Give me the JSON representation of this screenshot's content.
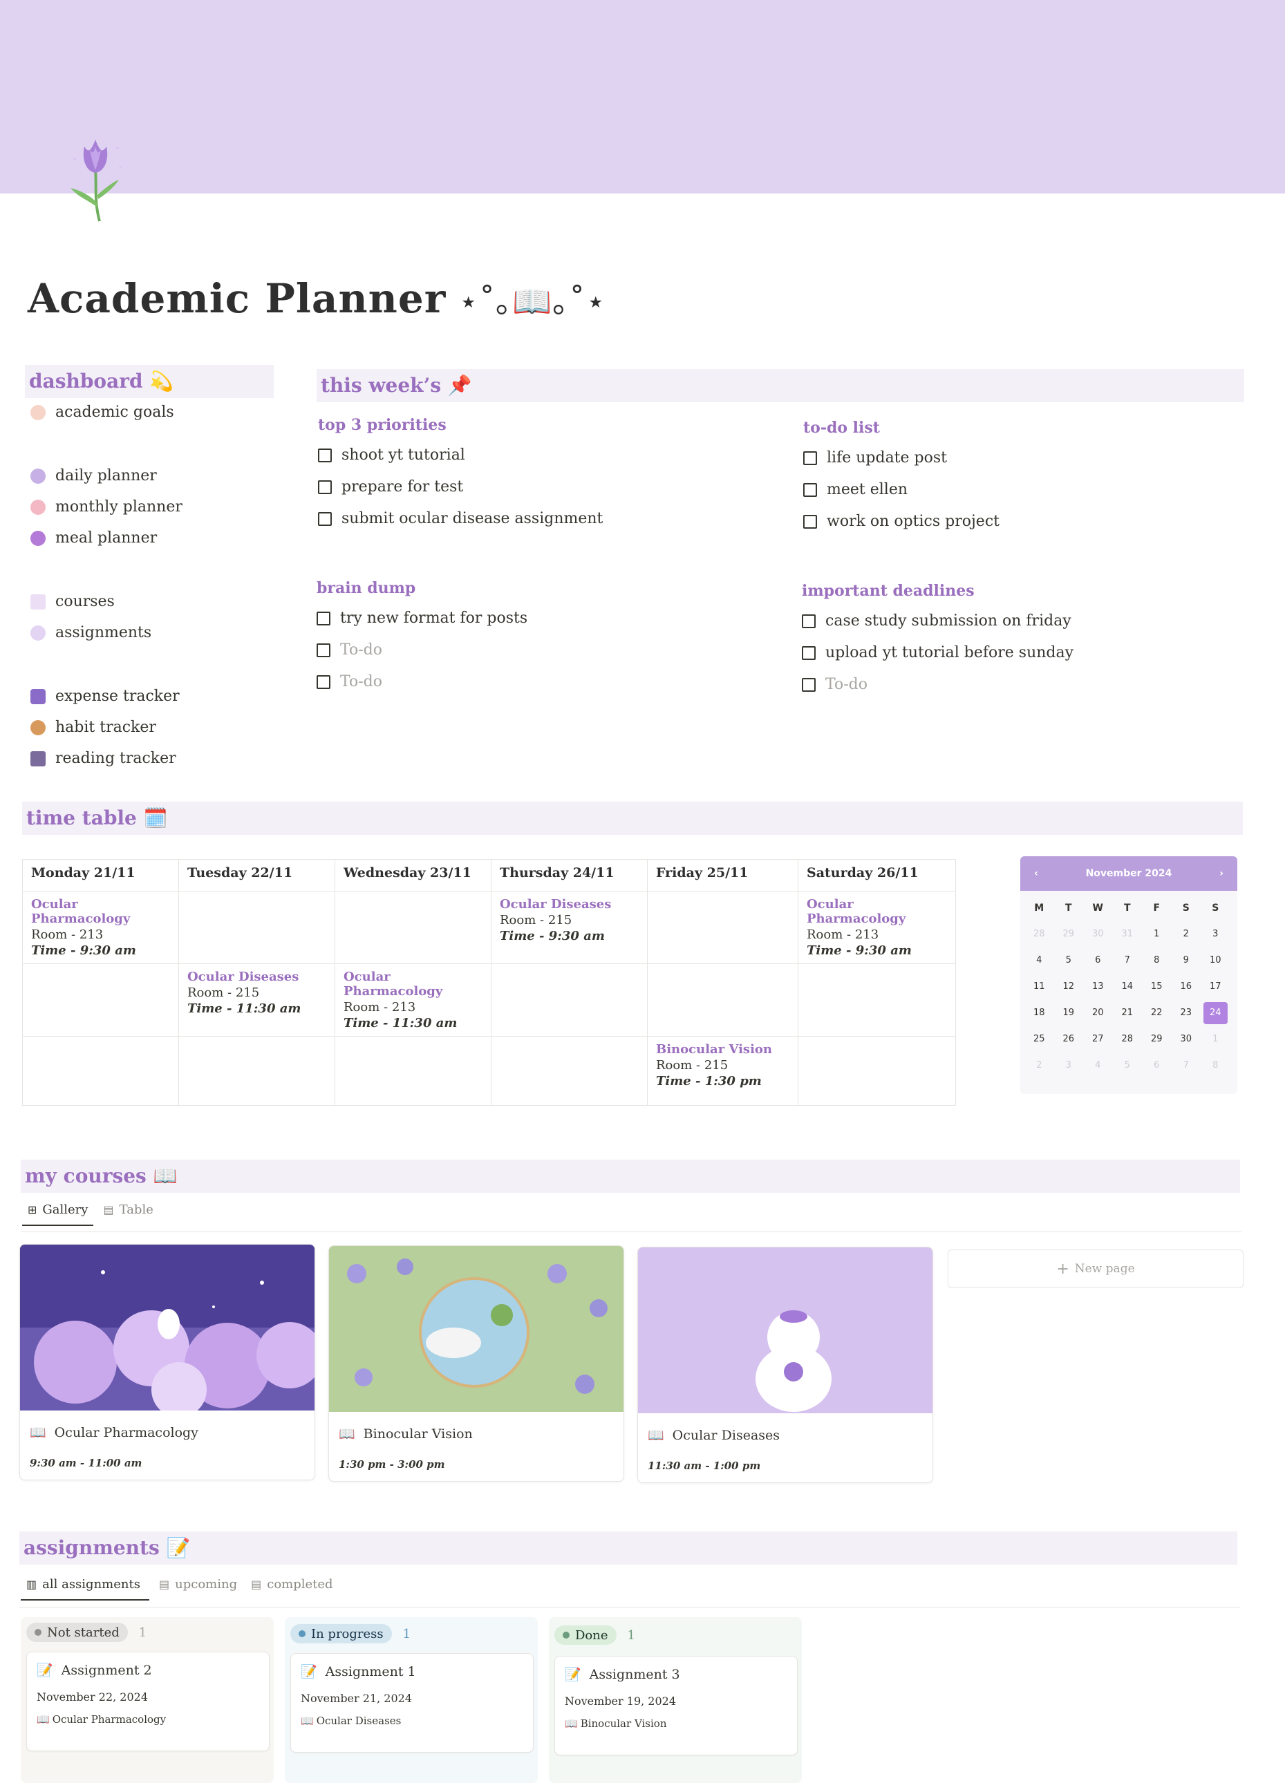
{
  "page": {
    "title": "Academic Planner",
    "title_deco": "⋆˚｡📖｡˚⋆"
  },
  "colors": {
    "cover": "#e0d3f2",
    "accent": "#9a6fbe",
    "section_bg": "#f3f0f8",
    "calendar_header": "#b9a0dd",
    "calendar_selected": "#b084e0"
  },
  "dashboard": {
    "title": "dashboard 💫",
    "items": [
      {
        "icon": "rainbow-icon",
        "label": "academic goals"
      },
      {
        "icon": "lavender-icon",
        "label": "daily planner"
      },
      {
        "icon": "pink-flower-icon",
        "label": "monthly planner"
      },
      {
        "icon": "donut-icon",
        "label": "meal planner"
      },
      {
        "icon": "notebook-icon",
        "label": "courses"
      },
      {
        "icon": "sparkle-pen-icon",
        "label": "assignments"
      },
      {
        "icon": "jar-icon",
        "label": "expense tracker"
      },
      {
        "icon": "wand-icon",
        "label": "habit tracker"
      },
      {
        "icon": "books-icon",
        "label": "reading tracker"
      }
    ]
  },
  "week": {
    "title": "this week’s 📌",
    "priorities": {
      "title": "top 3 priorities",
      "items": [
        "shoot yt tutorial",
        "prepare for test",
        "submit ocular disease assignment"
      ]
    },
    "todo": {
      "title": "to-do list",
      "items": [
        "life update post",
        "meet ellen",
        "work on optics project"
      ]
    },
    "brain_dump": {
      "title": "brain dump",
      "items": [
        "try new format for posts"
      ],
      "placeholders": [
        "To-do",
        "To-do"
      ]
    },
    "deadlines": {
      "title": "important deadlines",
      "items": [
        "case study submission on friday",
        "upload yt tutorial before sunday"
      ],
      "placeholders": [
        "To-do"
      ]
    }
  },
  "timetable": {
    "title": "time table 🗓️",
    "days": [
      "Monday 21/11",
      "Tuesday 22/11",
      "Wednesday 23/11",
      "Thursday 24/11",
      "Friday 25/11",
      "Saturday 26/11"
    ],
    "rows": [
      [
        {
          "name": "Ocular Pharmacology",
          "room": "Room - 213",
          "time": "Time - 9:30 am"
        },
        null,
        null,
        {
          "name": "Ocular Diseases",
          "room": "Room - 215",
          "time": "Time - 9:30 am"
        },
        null,
        {
          "name": "Ocular Pharmacology",
          "room": "Room - 213",
          "time": "Time - 9:30 am"
        }
      ],
      [
        null,
        {
          "name": "Ocular Diseases",
          "room": "Room - 215",
          "time": "Time - 11:30 am"
        },
        {
          "name": "Ocular Pharmacology",
          "room": "Room - 213",
          "time": "Time - 11:30 am"
        },
        null,
        null,
        null
      ],
      [
        null,
        null,
        null,
        null,
        {
          "name": "Binocular Vision",
          "room": "Room - 215",
          "time": "Time - 1:30 pm"
        },
        null
      ]
    ]
  },
  "calendar": {
    "month": "November 2024",
    "prev": "‹",
    "next": "›",
    "weekdays": [
      "M",
      "T",
      "W",
      "T",
      "F",
      "S",
      "S"
    ],
    "days": [
      {
        "d": "28",
        "m": true
      },
      {
        "d": "29",
        "m": true
      },
      {
        "d": "30",
        "m": true
      },
      {
        "d": "31",
        "m": true
      },
      {
        "d": "1"
      },
      {
        "d": "2"
      },
      {
        "d": "3"
      },
      {
        "d": "4"
      },
      {
        "d": "5"
      },
      {
        "d": "6"
      },
      {
        "d": "7"
      },
      {
        "d": "8"
      },
      {
        "d": "9"
      },
      {
        "d": "10"
      },
      {
        "d": "11"
      },
      {
        "d": "12"
      },
      {
        "d": "13"
      },
      {
        "d": "14"
      },
      {
        "d": "15"
      },
      {
        "d": "16"
      },
      {
        "d": "17"
      },
      {
        "d": "18"
      },
      {
        "d": "19"
      },
      {
        "d": "20"
      },
      {
        "d": "21"
      },
      {
        "d": "22"
      },
      {
        "d": "23"
      },
      {
        "d": "24",
        "sel": true
      },
      {
        "d": "25"
      },
      {
        "d": "26"
      },
      {
        "d": "27"
      },
      {
        "d": "28"
      },
      {
        "d": "29"
      },
      {
        "d": "30"
      },
      {
        "d": "1",
        "m": true
      },
      {
        "d": "2",
        "m": true
      },
      {
        "d": "3",
        "m": true
      },
      {
        "d": "4",
        "m": true
      },
      {
        "d": "5",
        "m": true
      },
      {
        "d": "6",
        "m": true
      },
      {
        "d": "7",
        "m": true
      },
      {
        "d": "8",
        "m": true
      }
    ]
  },
  "courses": {
    "title": "my courses 📖",
    "views": [
      "Gallery",
      "Table"
    ],
    "cards": [
      {
        "title": "Ocular Pharmacology",
        "time": "9:30 am - 11:00 am"
      },
      {
        "title": "Binocular Vision",
        "time": "1:30 pm - 3:00 pm"
      },
      {
        "title": "Ocular Diseases",
        "time": "11:30 am - 1:00 pm"
      }
    ],
    "new_page": "New page"
  },
  "assignments": {
    "title": "assignments 📝",
    "views": [
      "all assignments",
      "upcoming",
      "completed"
    ],
    "columns": [
      {
        "status": "Not started",
        "count": "1",
        "card": {
          "title": "Assignment 2",
          "date": "November 22, 2024",
          "course": "Ocular Pharmacology"
        }
      },
      {
        "status": "In progress",
        "count": "1",
        "card": {
          "title": "Assignment 1",
          "date": "November 21, 2024",
          "course": "Ocular Diseases"
        }
      },
      {
        "status": "Done",
        "count": "1",
        "card": {
          "title": "Assignment 3",
          "date": "November 19, 2024",
          "course": "Binocular Vision"
        }
      }
    ]
  }
}
